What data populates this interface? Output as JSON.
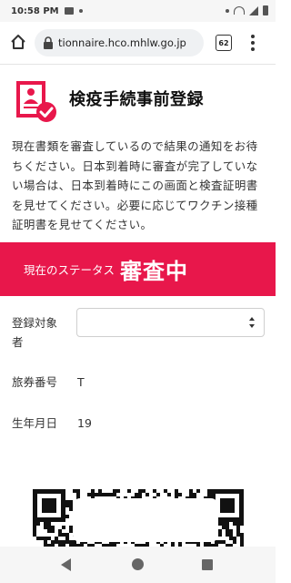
{
  "status_bar": {
    "time": "10:58 PM"
  },
  "browser": {
    "url": "tionnaire.hco.mhlw.go.jp",
    "tab_count": "62"
  },
  "page": {
    "title": "検疫手続事前登録",
    "notice": "現在書類を審査しているので結果の通知をお待ちください。日本到着時に審査が完了していない場合は、日本到着時にこの画面と検査証明書を見せてください。必要に応じてワクチン接種証明書を見せてください。"
  },
  "status": {
    "label": "現在のステータス",
    "value": "審査中",
    "color": "#e8174b"
  },
  "form": {
    "registrant_label": "登録対象者",
    "registrant_selected": "",
    "passport_label": "旅券番号",
    "passport_value": "T",
    "dob_label": "生年月日",
    "dob_value": "19"
  },
  "icons": {
    "home": "home-icon",
    "lock": "lock-icon",
    "menu": "more-vert-icon",
    "logo": "person-check-icon"
  }
}
